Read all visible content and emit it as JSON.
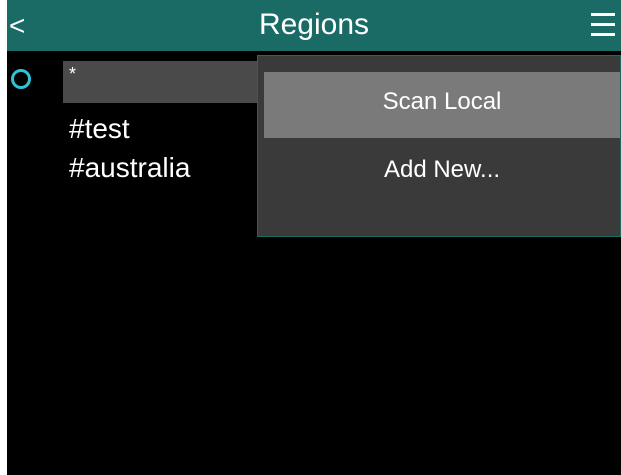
{
  "header": {
    "back_label": "<",
    "title": "Regions",
    "menu_icon": "hamburger-menu-icon"
  },
  "list": {
    "selected_indicator": "radio-ring-icon",
    "items": [
      {
        "label": "*",
        "selected": true
      },
      {
        "label": "#test",
        "selected": false
      },
      {
        "label": "#australia",
        "selected": false
      }
    ]
  },
  "menu": {
    "items": [
      {
        "label": "Scan Local",
        "highlighted": true
      },
      {
        "label": "Add New...",
        "highlighted": false
      }
    ]
  },
  "colors": {
    "header_bg": "#1a6b66",
    "screen_bg": "#000000",
    "radio_accent": "#2ec3d6",
    "menu_bg": "#3a3a3a",
    "menu_highlight": "#7a7a7a",
    "selected_row_bg": "#4a4a4a"
  }
}
